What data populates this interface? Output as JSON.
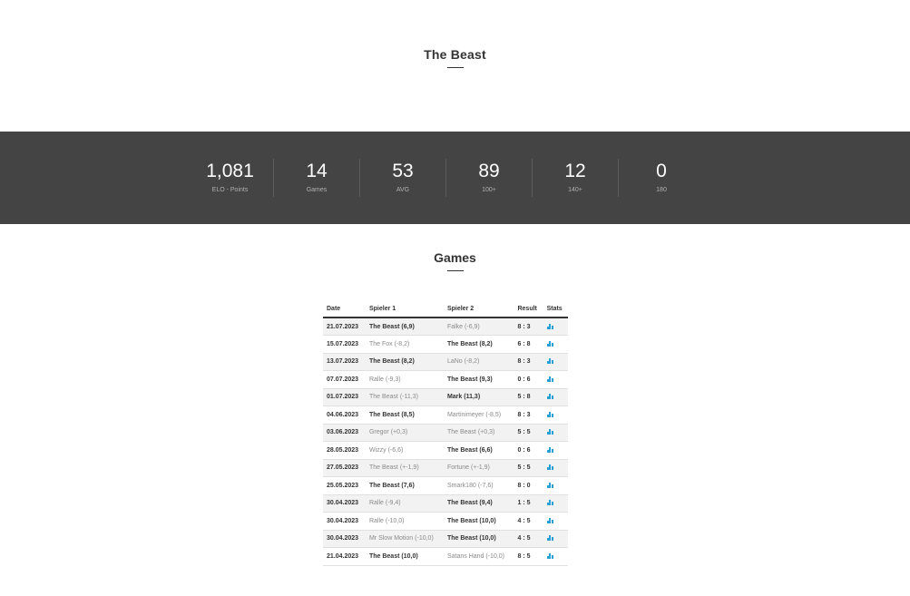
{
  "player": {
    "name": "The Beast"
  },
  "stats": [
    {
      "value": "1,081",
      "label": "ELO - Points"
    },
    {
      "value": "14",
      "label": "Games"
    },
    {
      "value": "53",
      "label": "AVG"
    },
    {
      "value": "89",
      "label": "100+"
    },
    {
      "value": "12",
      "label": "140+"
    },
    {
      "value": "0",
      "label": "180"
    }
  ],
  "games": {
    "title": "Games",
    "columns": [
      "Date",
      "Spieler 1",
      "Spieler 2",
      "Result",
      "Stats"
    ],
    "rows": [
      {
        "date": "21.07.2023",
        "p1": "The Beast",
        "p1_score": "(6,9)",
        "p2": "Falke",
        "p2_score": "(-6,9)",
        "result": "8 : 3",
        "winner": 1,
        "stats_icon": "stats-chart-icon"
      },
      {
        "date": "15.07.2023",
        "p1": "The Fox",
        "p1_score": "(-8,2)",
        "p2": "The Beast",
        "p2_score": "(8,2)",
        "result": "6 : 8",
        "winner": 2,
        "stats_icon": "stats-chart-icon"
      },
      {
        "date": "13.07.2023",
        "p1": "The Beast",
        "p1_score": "(8,2)",
        "p2": "LaNo",
        "p2_score": "(-8,2)",
        "result": "8 : 3",
        "winner": 1,
        "stats_icon": "stats-chart-icon"
      },
      {
        "date": "07.07.2023",
        "p1": "Ralle",
        "p1_score": "(-9,3)",
        "p2": "The Beast",
        "p2_score": "(9,3)",
        "result": "0 : 6",
        "winner": 2,
        "stats_icon": "stats-chart-icon"
      },
      {
        "date": "01.07.2023",
        "p1": "The Beast",
        "p1_score": "(-11,3)",
        "p2": "Mark",
        "p2_score": "(11,3)",
        "result": "5 : 8",
        "winner": 2,
        "stats_icon": "stats-chart-icon"
      },
      {
        "date": "04.06.2023",
        "p1": "The Beast",
        "p1_score": "(8,5)",
        "p2": "Martinimeyer",
        "p2_score": "(-8,5)",
        "result": "8 : 3",
        "winner": 1,
        "stats_icon": "stats-chart-icon"
      },
      {
        "date": "03.06.2023",
        "p1": "Gregor",
        "p1_score": "(+0,3)",
        "p2": "The Beast",
        "p2_score": "(+0,3)",
        "result": "5 : 5",
        "winner": 0,
        "stats_icon": "stats-chart-icon"
      },
      {
        "date": "28.05.2023",
        "p1": "Wizzy",
        "p1_score": "(-6,6)",
        "p2": "The Beast",
        "p2_score": "(6,6)",
        "result": "0 : 6",
        "winner": 2,
        "stats_icon": "stats-chart-icon"
      },
      {
        "date": "27.05.2023",
        "p1": "The Beast",
        "p1_score": "(+-1,9)",
        "p2": "Fortune",
        "p2_score": "(+-1,9)",
        "result": "5 : 5",
        "winner": 0,
        "stats_icon": "stats-chart-icon"
      },
      {
        "date": "25.05.2023",
        "p1": "The Beast",
        "p1_score": "(7,6)",
        "p2": "Smark180",
        "p2_score": "(-7,6)",
        "result": "8 : 0",
        "winner": 1,
        "stats_icon": "stats-chart-icon"
      },
      {
        "date": "30.04.2023",
        "p1": "Ralle",
        "p1_score": "(-9,4)",
        "p2": "The Beast",
        "p2_score": "(9,4)",
        "result": "1 : 5",
        "winner": 2,
        "stats_icon": "stats-chart-icon"
      },
      {
        "date": "30.04.2023",
        "p1": "Ralle",
        "p1_score": "(-10,0)",
        "p2": "The Beast",
        "p2_score": "(10,0)",
        "result": "4 : 5",
        "winner": 2,
        "stats_icon": "stats-chart-icon"
      },
      {
        "date": "30.04.2023",
        "p1": "Mr Slow Motion",
        "p1_score": "(-10,0)",
        "p2": "The Beast",
        "p2_score": "(10,0)",
        "result": "4 : 5",
        "winner": 2,
        "stats_icon": "stats-chart-icon"
      },
      {
        "date": "21.04.2023",
        "p1": "The Beast",
        "p1_score": "(10,0)",
        "p2": "Satans Hand",
        "p2_score": "(-10,0)",
        "result": "8 : 5",
        "winner": 1,
        "stats_icon": "stats-chart-icon"
      }
    ]
  },
  "colors": {
    "band": "#444444",
    "text": "#333333",
    "muted": "#8a8a8a",
    "accent": "#2a9fd6"
  }
}
